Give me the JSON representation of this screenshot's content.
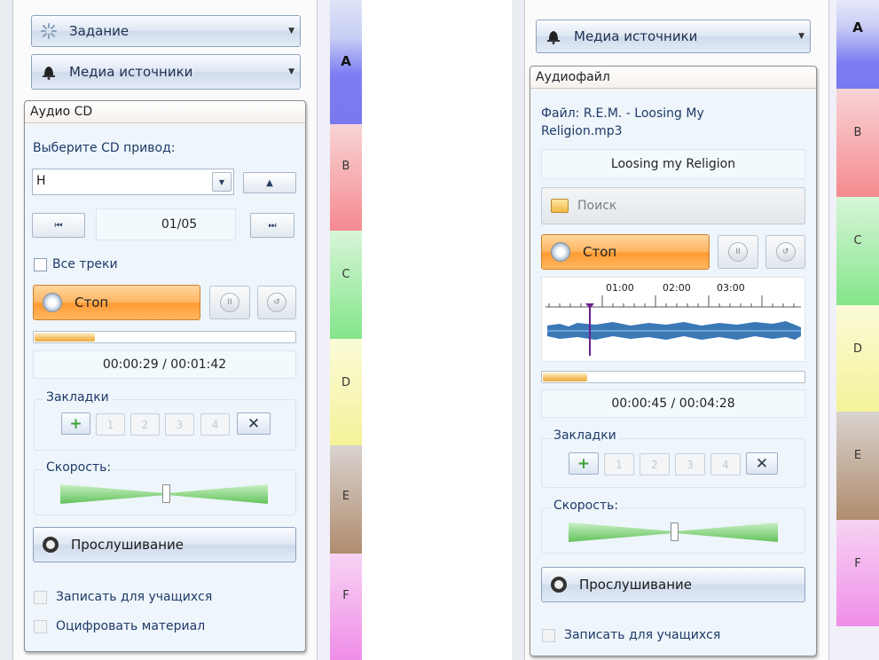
{
  "left": {
    "task_button": "Задание",
    "media_button": "Медиа источники",
    "panel_title": "Аудио CD",
    "drive_label": "Выберите CD привод:",
    "drive_value": "H",
    "track_display": "01/05",
    "all_tracks_label": "Все треки",
    "stop_label": "Стоп",
    "progress_fraction": 0.23,
    "time_display": "00:00:29 / 00:01:42",
    "bookmarks_label": "Закладки",
    "bookmark_numbers": [
      "1",
      "2",
      "3",
      "4"
    ],
    "speed_label": "Скорость:",
    "listen_label": "Прослушивание",
    "record_label": "Записать для учащихся",
    "digitize_label": "Оцифровать материал"
  },
  "right": {
    "media_button": "Медиа источники",
    "panel_title": "Аудиофайл",
    "file_label": "Файл: R.E.M. - Loosing My Religion.mp3",
    "track_title": "Loosing my Religion",
    "search_label": "Поиск",
    "stop_label": "Стоп",
    "wave_ticks": [
      "01:00",
      "02:00",
      "03:00"
    ],
    "progress_fraction": 0.17,
    "time_display": "00:00:45 / 00:04:28",
    "bookmarks_label": "Закладки",
    "bookmark_numbers": [
      "1",
      "2",
      "3",
      "4"
    ],
    "speed_label": "Скорость:",
    "listen_label": "Прослушивание",
    "record_label": "Записать для учащихся"
  },
  "strip_letters": [
    "A",
    "B",
    "C",
    "D",
    "E",
    "F"
  ],
  "strip_colors": {
    "A": "#7d7df2",
    "B": "#f58a8f",
    "C": "#84e58a",
    "D": "#f4f298",
    "E": "#b08c6e",
    "F": "#ef8ee8"
  }
}
